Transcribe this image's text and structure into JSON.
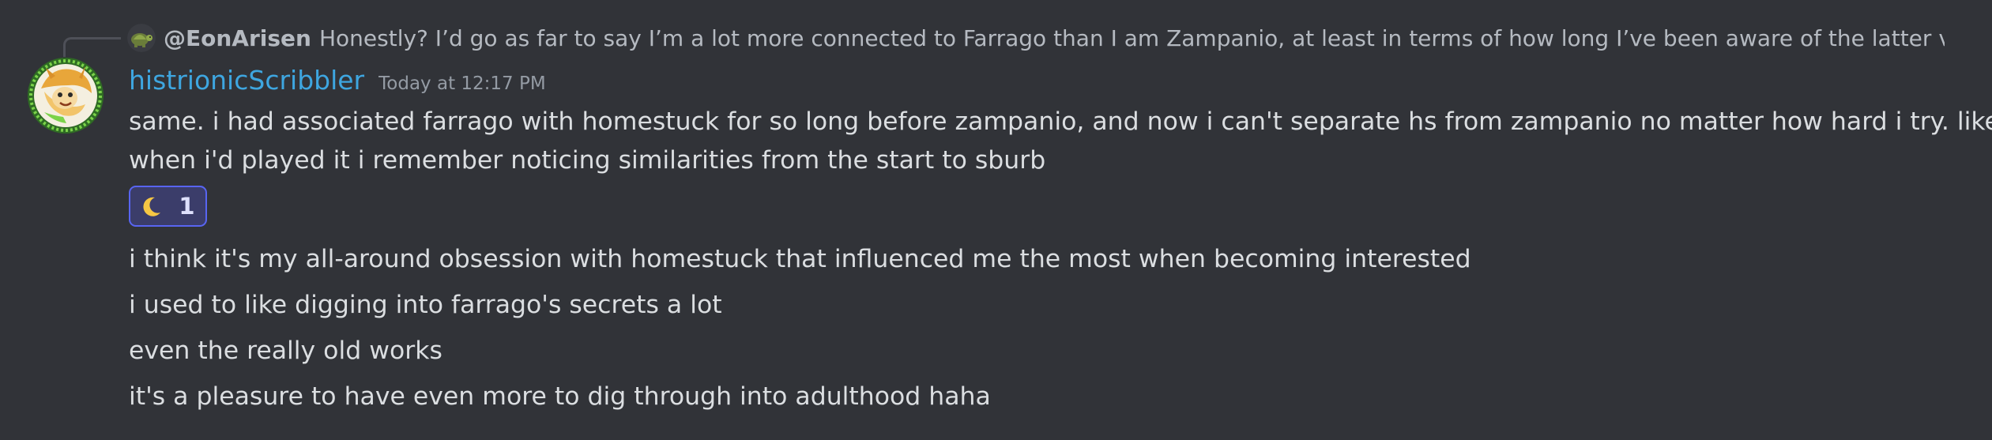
{
  "reply": {
    "author": "@EonArisen",
    "text": "Honestly? I’d go as far to say I’m a lot more connected to Farrago than I am Zampanio, at least in terms of how long I’ve been aware of the latter versus the fo"
  },
  "message": {
    "username": "histrionicScribbler",
    "timestamp": "Today at 12:17 PM",
    "line1": "same. i had associated farrago with homestuck for so long before zampanio, and now i can't separate hs from zampanio no matter how hard i try. like",
    "line2": "when i'd played it i remember noticing similarities from the start to sburb",
    "reaction": {
      "emoji": "crescent-moon-icon",
      "count": "1"
    }
  },
  "followups": [
    "i think it's my all-around obsession with homestuck that influenced me the most when becoming interested",
    "i used to like digging into farrago's secrets a lot",
    "even the really old works",
    "it's a pleasure to have even more to dig through into adulthood haha"
  ],
  "colors": {
    "background": "#313338",
    "username": "#3ea6e0",
    "reaction_border": "#5865f2",
    "reaction_bg": "#3b3d6a"
  }
}
